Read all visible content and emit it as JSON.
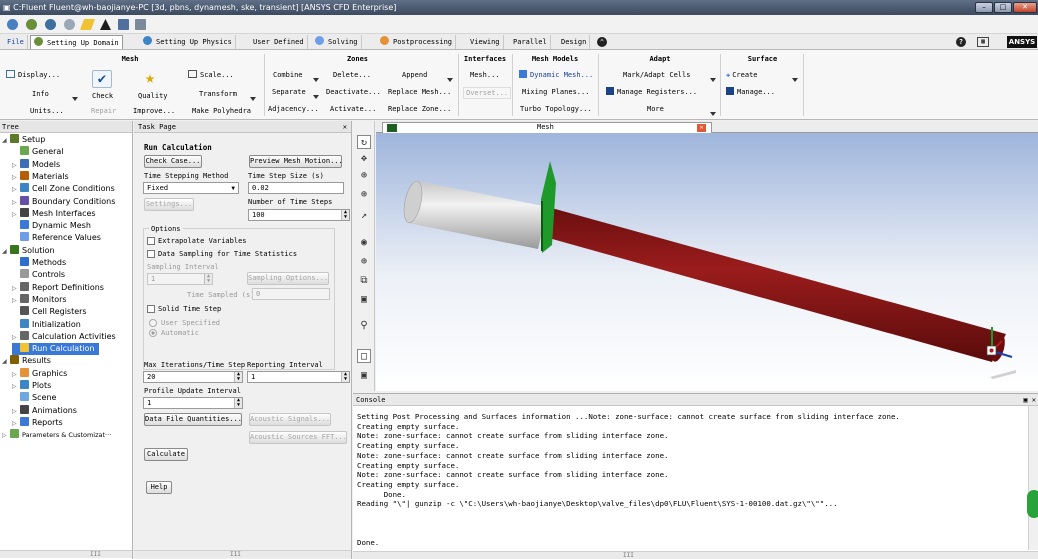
{
  "window": {
    "title": "C:Fluent Fluent@wh-baojianye-PC  [3d, pbns, dynamesh, ske, transient] [ANSYS CFD Enterprise]",
    "min_label": "–",
    "max_label": "□",
    "close_label": "✕"
  },
  "ribbon_tabs": [
    {
      "label": "File"
    },
    {
      "label": "Setting Up Domain"
    },
    {
      "label": "Setting Up Physics"
    },
    {
      "label": "User Defined"
    },
    {
      "label": "Solving"
    },
    {
      "label": "Postprocessing"
    },
    {
      "label": "Viewing"
    },
    {
      "label": "Parallel"
    },
    {
      "label": "Design"
    }
  ],
  "brand": "ANSYS",
  "ribbon": {
    "mesh": {
      "title": "Mesh",
      "display": "Display...",
      "info": "Info",
      "units": "Units...",
      "check": "Check",
      "repair": "Repair",
      "quality": "Quality",
      "improve": "Improve...",
      "scale": "Scale...",
      "transform": "Transform",
      "make_polyhedra": "Make Polyhedra"
    },
    "zones": {
      "title": "Zones",
      "combine": "Combine",
      "separate": "Separate",
      "adjacency": "Adjacency...",
      "delete": "Delete...",
      "deactivate": "Deactivate...",
      "activate": "Activate...",
      "append": "Append",
      "replace_mesh": "Replace Mesh...",
      "replace_zone": "Replace Zone..."
    },
    "interfaces": {
      "title": "Interfaces",
      "mesh": "Mesh...",
      "overset": "Overset..."
    },
    "mesh_models": {
      "title": "Mesh Models",
      "dynamic_mesh": "Dynamic Mesh...",
      "mixing_planes": "Mixing Planes...",
      "turbo_topology": "Turbo Topology..."
    },
    "adapt": {
      "title": "Adapt",
      "mark_adapt": "Mark/Adapt Cells",
      "manage_registers": "Manage Registers...",
      "more": "More"
    },
    "surface": {
      "title": "Surface",
      "create": "Create",
      "manage": "Manage..."
    }
  },
  "tree": {
    "header": "Tree",
    "items": [
      {
        "label": "Setup",
        "level": 0,
        "exp": "◢",
        "icon": "setup-icon",
        "color": "#5a7a2a"
      },
      {
        "label": "General",
        "level": 1,
        "exp": "",
        "icon": "general-icon",
        "color": "#6aa84f"
      },
      {
        "label": "Models",
        "level": 1,
        "exp": "▷",
        "icon": "models-icon",
        "color": "#3d6fb6"
      },
      {
        "label": "Materials",
        "level": 1,
        "exp": "▷",
        "icon": "materials-icon",
        "color": "#b45f06"
      },
      {
        "label": "Cell Zone Conditions",
        "level": 1,
        "exp": "▷",
        "icon": "cell-zone-icon",
        "color": "#3d85c6"
      },
      {
        "label": "Boundary Conditions",
        "level": 1,
        "exp": "▷",
        "icon": "boundary-icon",
        "color": "#674ea7"
      },
      {
        "label": "Mesh Interfaces",
        "level": 1,
        "exp": "▷",
        "icon": "interfaces-icon",
        "color": "#444444"
      },
      {
        "label": "Dynamic Mesh",
        "level": 1,
        "exp": "",
        "icon": "dynamic-mesh-icon",
        "color": "#3c78d8"
      },
      {
        "label": "Reference Values",
        "level": 1,
        "exp": "",
        "icon": "reference-icon",
        "color": "#6d9eeb"
      },
      {
        "label": "Solution",
        "level": 0,
        "exp": "◢",
        "icon": "solution-icon",
        "color": "#38761d"
      },
      {
        "label": "Methods",
        "level": 1,
        "exp": "",
        "icon": "methods-icon",
        "color": "#2f6dd1"
      },
      {
        "label": "Controls",
        "level": 1,
        "exp": "",
        "icon": "controls-icon",
        "color": "#999999"
      },
      {
        "label": "Report Definitions",
        "level": 1,
        "exp": "▷",
        "icon": "report-def-icon",
        "color": "#666666"
      },
      {
        "label": "Monitors",
        "level": 1,
        "exp": "▷",
        "icon": "monitors-icon",
        "color": "#666666"
      },
      {
        "label": "Cell Registers",
        "level": 1,
        "exp": "",
        "icon": "cell-registers-icon",
        "color": "#555555"
      },
      {
        "label": "Initialization",
        "level": 1,
        "exp": "",
        "icon": "initialization-icon",
        "color": "#3d85c6"
      },
      {
        "label": "Calculation Activities",
        "level": 1,
        "exp": "▷",
        "icon": "calc-activities-icon",
        "color": "#666666"
      },
      {
        "label": "Run Calculation",
        "level": 1,
        "exp": "",
        "icon": "run-calculation-icon",
        "color": "#f1c232",
        "selected": true
      },
      {
        "label": "Results",
        "level": 0,
        "exp": "◢",
        "icon": "results-icon",
        "color": "#7f6000"
      },
      {
        "label": "Graphics",
        "level": 1,
        "exp": "▷",
        "icon": "graphics-icon",
        "color": "#e69138"
      },
      {
        "label": "Plots",
        "level": 1,
        "exp": "▷",
        "icon": "plots-icon",
        "color": "#3d85c6"
      },
      {
        "label": "Scene",
        "level": 1,
        "exp": "",
        "icon": "scene-icon",
        "color": "#6fa8dc"
      },
      {
        "label": "Animations",
        "level": 1,
        "exp": "▷",
        "icon": "animations-icon",
        "color": "#444444"
      },
      {
        "label": "Reports",
        "level": 1,
        "exp": "▷",
        "icon": "reports-icon",
        "color": "#3c78d8"
      },
      {
        "label": "Parameters & Customizat···",
        "level": 0,
        "exp": "▷",
        "icon": "parameters-icon",
        "color": "#6aa84f",
        "small": true
      }
    ]
  },
  "task": {
    "header": "Task Page",
    "title": "Run Calculation",
    "check_case": "Check Case...",
    "preview_mesh_motion": "Preview Mesh Motion...",
    "time_stepping_label": "Time Stepping Method",
    "time_stepping_value": "Fixed",
    "time_step_size_label": "Time Step Size (s)",
    "time_step_size_value": "0.02",
    "settings": "Settings...",
    "num_time_steps_label": "Number of Time Steps",
    "num_time_steps_value": "100",
    "options_title": "Options",
    "extrapolate_variables": "Extrapolate Variables",
    "data_sampling": "Data Sampling for Time Statistics",
    "sampling_interval_label": "Sampling Interval",
    "sampling_interval_value": "1",
    "sampling_options": "Sampling Options...",
    "time_sampled_label": "Time Sampled (s)",
    "time_sampled_value": "0",
    "solid_time_step": "Solid Time Step",
    "user_specified": "User Specified",
    "automatic": "Automatic",
    "max_iterations_label": "Max Iterations/Time Step",
    "max_iterations_value": "20",
    "reporting_interval_label": "Reporting Interval",
    "reporting_interval_value": "1",
    "profile_update_label": "Profile Update Interval",
    "profile_update_value": "1",
    "data_file_quantities": "Data File Quantities...",
    "acoustic_signals": "Acoustic Signals...",
    "acoustic_sources_fft": "Acoustic Sources FFT...",
    "calculate": "Calculate",
    "help": "Help"
  },
  "graphics": {
    "tab_title": "Mesh"
  },
  "console": {
    "title": "Console",
    "lines": [
      "Setting Post Processing and Surfaces information ...Note: zone-surface: cannot create surface from sliding interface zone.",
      "Creating empty surface.",
      "Note: zone-surface: cannot create surface from sliding interface zone.",
      "Creating empty surface.",
      "Note: zone-surface: cannot create surface from sliding interface zone.",
      "Creating empty surface.",
      "Note: zone-surface: cannot create surface from sliding interface zone.",
      "Creating empty surface.",
      "      Done.",
      "Reading \"\\\"| gunzip -c \\\"C:\\Users\\wh-baojianye\\Desktop\\valve_files\\dp0\\FLU\\Fluent\\SYS-1-00100.dat.gz\\\"\\\"\"...",
      "",
      "",
      "",
      "Done."
    ]
  },
  "scroll_label": "III"
}
